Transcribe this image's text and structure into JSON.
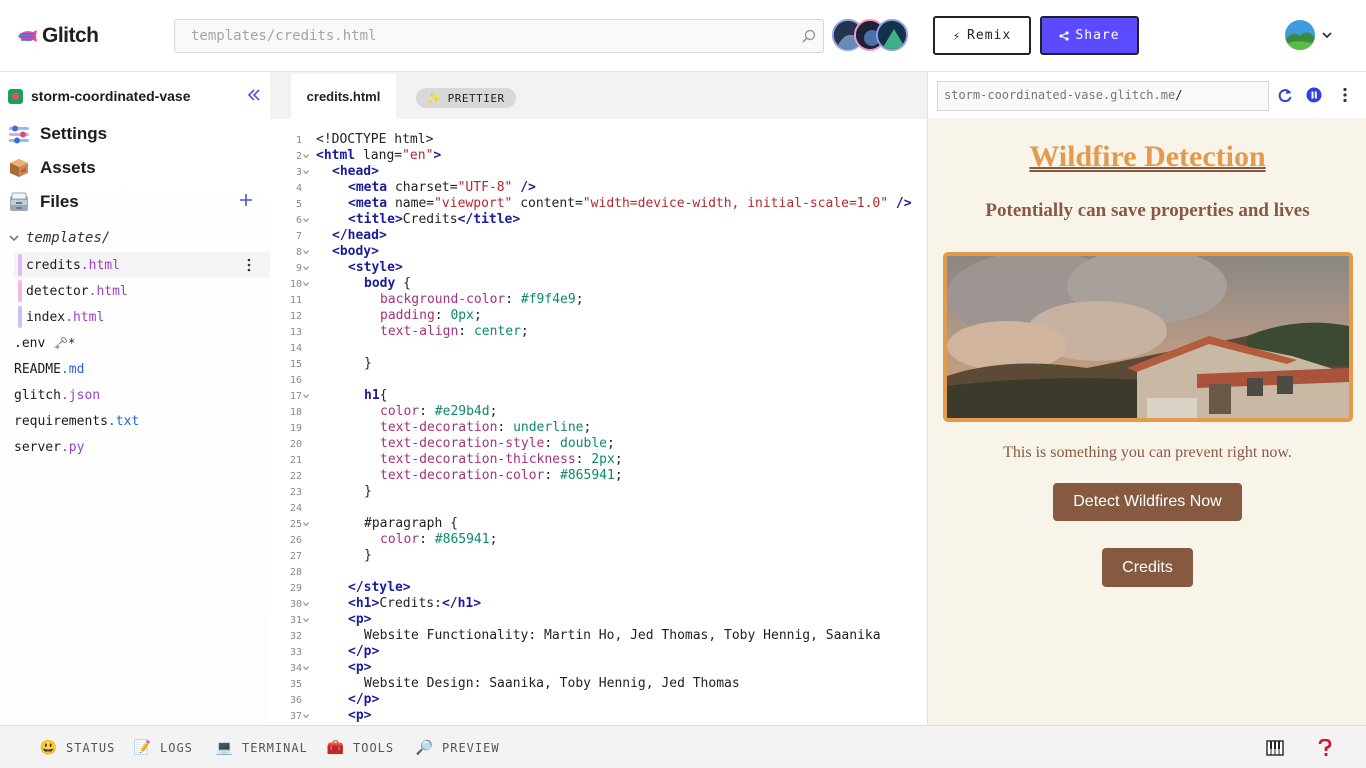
{
  "app": {
    "name": "Glitch"
  },
  "search": {
    "placeholder": "templates/credits.html"
  },
  "header": {
    "remix_label": "Remix",
    "share_label": "Share"
  },
  "sidebar": {
    "project_name": "storm-coordinated-vase",
    "nav": [
      {
        "label": "Settings",
        "icon": "settings-icon"
      },
      {
        "label": "Assets",
        "icon": "assets-box-icon"
      },
      {
        "label": "Files",
        "icon": "files-drawer-icon"
      }
    ],
    "folder": "templates/",
    "files": [
      {
        "name": "credits",
        "ext": ".html",
        "indent": true,
        "selected": true,
        "bar_color": "#e2b7f5"
      },
      {
        "name": "detector",
        "ext": ".html",
        "indent": true,
        "bar_color": "#f6b7d8"
      },
      {
        "name": "index",
        "ext": ".html",
        "indent": true,
        "bar_color": "#c9c2f7"
      },
      {
        "name": ".env",
        "ext": "",
        "suffix": "🗝️*"
      },
      {
        "name": "README",
        "ext": ".md"
      },
      {
        "name": "glitch",
        "ext": ".json",
        "pink": true
      },
      {
        "name": "requirements",
        "ext": ".txt"
      },
      {
        "name": "server",
        "ext": ".py",
        "pink": true
      }
    ]
  },
  "editor": {
    "active_tab": "credits.html",
    "prettier_label": "PRETTIER",
    "lines": [
      {
        "n": "1",
        "fold": false,
        "indent": 0,
        "html": "<span class='at'>&lt;!DOCTYPE html&gt;</span>"
      },
      {
        "n": "2",
        "fold": true,
        "indent": 0,
        "html": "<span class='tg'>&lt;html</span> lang=<span class='st'>\"en\"</span><span class='tg'>&gt;</span>"
      },
      {
        "n": "3",
        "fold": true,
        "indent": 2,
        "html": "<span class='tg'>&lt;head&gt;</span>"
      },
      {
        "n": "4",
        "fold": false,
        "indent": 4,
        "html": "<span class='tg'>&lt;meta</span> charset=<span class='st'>\"UTF-8\"</span> <span class='tg'>/&gt;</span>"
      },
      {
        "n": "5",
        "fold": false,
        "indent": 4,
        "html": "<span class='tg'>&lt;meta</span> name=<span class='st'>\"viewport\"</span> content=<span class='st'>\"width=device-width, initial-scale=1.0\"</span> <span class='tg'>/&gt;</span>"
      },
      {
        "n": "6",
        "fold": true,
        "indent": 4,
        "html": "<span class='tg'>&lt;title&gt;</span>Credits<span class='tg'>&lt;/title&gt;</span>"
      },
      {
        "n": "7",
        "fold": false,
        "indent": 2,
        "html": "<span class='tg'>&lt;/head&gt;</span>"
      },
      {
        "n": "8",
        "fold": true,
        "indent": 2,
        "html": "<span class='tg'>&lt;body&gt;</span>"
      },
      {
        "n": "9",
        "fold": true,
        "indent": 4,
        "html": "<span class='tg'>&lt;style&gt;</span>"
      },
      {
        "n": "10",
        "fold": true,
        "indent": 6,
        "html": "<span class='sel'>body</span> {"
      },
      {
        "n": "11",
        "fold": false,
        "indent": 8,
        "html": "<span class='pr'>background-color</span>: <span class='vl'>#f9f4e9</span>;"
      },
      {
        "n": "12",
        "fold": false,
        "indent": 8,
        "html": "<span class='pr'>padding</span>: <span class='vl'>0px</span>;"
      },
      {
        "n": "13",
        "fold": false,
        "indent": 8,
        "html": "<span class='pr'>text-align</span>: <span class='vl'>center</span>;"
      },
      {
        "n": "14",
        "fold": false,
        "indent": 0,
        "html": ""
      },
      {
        "n": "15",
        "fold": false,
        "indent": 6,
        "html": "}"
      },
      {
        "n": "16",
        "fold": false,
        "indent": 0,
        "html": ""
      },
      {
        "n": "17",
        "fold": true,
        "indent": 6,
        "html": "<span class='sel'>h1</span>{"
      },
      {
        "n": "18",
        "fold": false,
        "indent": 8,
        "html": "<span class='pr'>color</span>: <span class='vl'>#e29b4d</span>;"
      },
      {
        "n": "19",
        "fold": false,
        "indent": 8,
        "html": "<span class='pr'>text-decoration</span>: <span class='vl'>underline</span>;"
      },
      {
        "n": "20",
        "fold": false,
        "indent": 8,
        "html": "<span class='pr'>text-decoration-style</span>: <span class='vl'>double</span>;"
      },
      {
        "n": "21",
        "fold": false,
        "indent": 8,
        "html": "<span class='pr'>text-decoration-thickness</span>: <span class='vl'>2px</span>;"
      },
      {
        "n": "22",
        "fold": false,
        "indent": 8,
        "html": "<span class='pr'>text-decoration-color</span>: <span class='vl'>#865941</span>;"
      },
      {
        "n": "23",
        "fold": false,
        "indent": 6,
        "html": "}"
      },
      {
        "n": "24",
        "fold": false,
        "indent": 0,
        "html": ""
      },
      {
        "n": "25",
        "fold": true,
        "indent": 6,
        "html": "#paragraph {"
      },
      {
        "n": "26",
        "fold": false,
        "indent": 8,
        "html": "<span class='pr'>color</span>: <span class='vl'>#865941</span>;"
      },
      {
        "n": "27",
        "fold": false,
        "indent": 6,
        "html": "}"
      },
      {
        "n": "28",
        "fold": false,
        "indent": 0,
        "html": ""
      },
      {
        "n": "29",
        "fold": false,
        "indent": 4,
        "html": "<span class='tg'>&lt;/style&gt;</span>"
      },
      {
        "n": "30",
        "fold": true,
        "indent": 4,
        "html": "<span class='tg'>&lt;h1&gt;</span>Credits:<span class='tg'>&lt;/h1&gt;</span>"
      },
      {
        "n": "31",
        "fold": true,
        "indent": 4,
        "html": "<span class='tg'>&lt;p&gt;</span>"
      },
      {
        "n": "32",
        "fold": false,
        "indent": 6,
        "html": "Website Functionality: Martin Ho, Jed Thomas, Toby Hennig, Saanika"
      },
      {
        "n": "33",
        "fold": false,
        "indent": 4,
        "html": "<span class='tg'>&lt;/p&gt;</span>"
      },
      {
        "n": "34",
        "fold": true,
        "indent": 4,
        "html": "<span class='tg'>&lt;p&gt;</span>"
      },
      {
        "n": "35",
        "fold": false,
        "indent": 6,
        "html": "Website Design: Saanika, Toby Hennig, Jed Thomas"
      },
      {
        "n": "36",
        "fold": false,
        "indent": 4,
        "html": "<span class='tg'>&lt;/p&gt;</span>"
      },
      {
        "n": "37",
        "fold": true,
        "indent": 4,
        "html": "<span class='tg'>&lt;p&gt;</span>"
      }
    ]
  },
  "preview": {
    "url_host": "storm-coordinated-vase.glitch.me",
    "url_path": "/",
    "heading": "Wildfire Detection",
    "subtitle": "Potentially can save properties and lives",
    "tagline": "This is something you can prevent right now.",
    "detect_button": "Detect Wildfires Now",
    "credits_button": "Credits"
  },
  "statusbar": [
    {
      "label": "STATUS",
      "icon": "😃"
    },
    {
      "label": "LOGS",
      "icon": "📝"
    },
    {
      "label": "TERMINAL",
      "icon": "💻"
    },
    {
      "label": "TOOLS",
      "icon": "🧰"
    },
    {
      "label": "PREVIEW",
      "icon": "🔎"
    }
  ],
  "colors": {
    "accent": "#5a4bff",
    "heading": "#e29b4d",
    "brown": "#865941",
    "preview_bg": "#f9f4e9"
  }
}
